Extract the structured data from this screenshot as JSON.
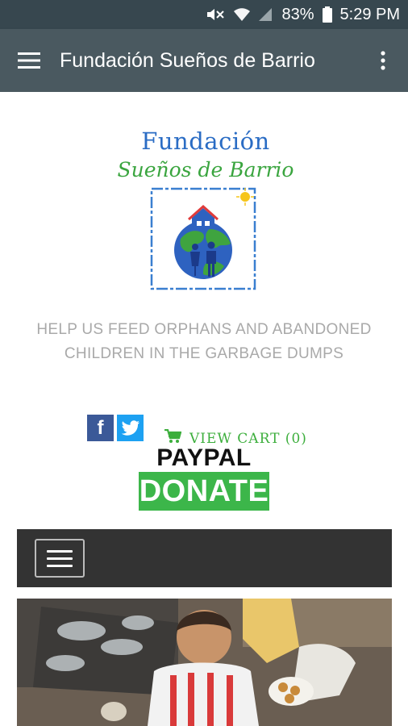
{
  "status_bar": {
    "battery": "83%",
    "time": "5:29 PM",
    "icons": [
      "mute-icon",
      "wifi-icon",
      "signal-icon",
      "battery-icon"
    ]
  },
  "app_bar": {
    "title": "Fundación Sueños de Barrio",
    "menu_icon": "hamburger-menu-icon",
    "overflow_icon": "more-vert-icon"
  },
  "logo": {
    "line1": "Fundación",
    "line2": "Sueños de Barrio"
  },
  "tagline": "HELP US FEED ORPHANS AND ABANDONED CHILDREN IN THE GARBAGE DUMPS",
  "social": {
    "facebook_glyph": "f",
    "icons": [
      "facebook-icon",
      "twitter-icon"
    ]
  },
  "cart": {
    "label": "VIEW CART (0)",
    "icon": "shopping-cart-icon"
  },
  "paypal": {
    "top": "PAYPAL",
    "button": "DONATE"
  },
  "navbar": {
    "toggle_icon": "hamburger-menu-icon"
  },
  "colors": {
    "app_bar": "#4a5960",
    "status_bar": "#37474f",
    "cart_green": "#3cae3c",
    "donate_green": "#3cb64a",
    "navbar": "#333333",
    "facebook": "#3b5998",
    "twitter": "#1da1f2"
  }
}
